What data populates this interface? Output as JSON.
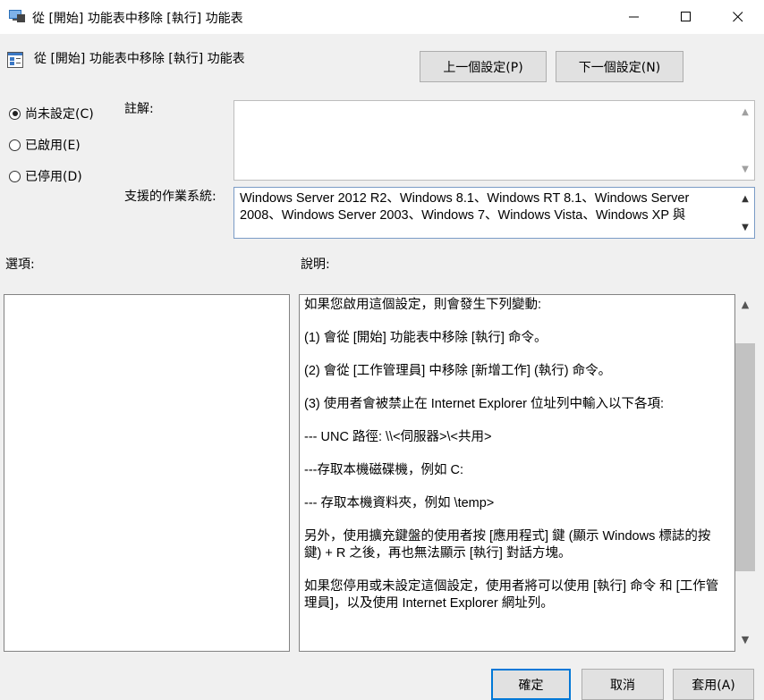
{
  "window": {
    "title": "從 [開始] 功能表中移除 [執行] 功能表",
    "minimize_glyph": "—",
    "maximize_glyph": "☐",
    "close_glyph": "✕"
  },
  "header": {
    "policy_title": "從 [開始] 功能表中移除 [執行] 功能表",
    "prev_label": "上一個設定(P)",
    "next_label": "下一個設定(N)"
  },
  "state_options": [
    {
      "label": "尚未設定(C)",
      "selected": true
    },
    {
      "label": "已啟用(E)",
      "selected": false
    },
    {
      "label": "已停用(D)",
      "selected": false
    }
  ],
  "comment": {
    "label": "註解:",
    "value": ""
  },
  "supported_on": {
    "label": "支援的作業系統:",
    "value": "Windows Server 2012 R2、Windows 8.1、Windows RT 8.1、Windows Server 2008、Windows Server 2003、Windows 7、Windows Vista、Windows XP 與"
  },
  "options": {
    "label": "選項:"
  },
  "help": {
    "label": "說明:",
    "paragraphs": [
      "如果您啟用這個設定，則會發生下列變動:",
      "(1) 會從 [開始] 功能表中移除 [執行] 命令。",
      "(2) 會從 [工作管理員] 中移除 [新增工作] (執行) 命令。",
      "(3) 使用者會被禁止在 Internet Explorer 位址列中輸入以下各項:",
      "--- UNC 路徑: \\\\<伺服器>\\<共用>",
      "---存取本機磁碟機，例如 C:",
      "--- 存取本機資料夾，例如 \\temp>",
      "另外，使用擴充鍵盤的使用者按 [應用程式] 鍵 (顯示 Windows 標誌的按鍵) + R 之後，再也無法顯示 [執行] 對話方塊。",
      "如果您停用或未設定這個設定，使用者將可以使用 [執行] 命令 和 [工作管理員]，以及使用 Internet Explorer 網址列。"
    ]
  },
  "footer": {
    "ok_label": "確定",
    "cancel_label": "取消",
    "apply_label": "套用(A)"
  },
  "colors": {
    "accent": "#0078d7",
    "background": "#f0f0f0"
  }
}
